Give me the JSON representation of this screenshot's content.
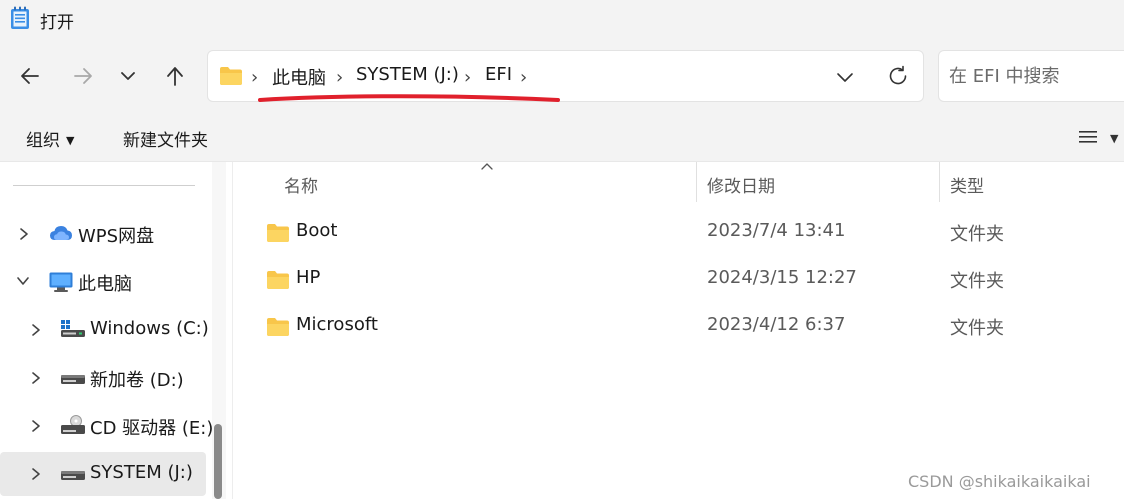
{
  "window": {
    "title": "打开"
  },
  "navigation": {
    "breadcrumb": [
      "此电脑",
      "SYSTEM (J:)",
      "EFI"
    ],
    "search_placeholder": "在 EFI 中搜索"
  },
  "toolbar": {
    "organize_label": "组织",
    "new_folder_label": "新建文件夹"
  },
  "sidebar": {
    "items": [
      {
        "label": "WPS网盘",
        "icon": "cloud-icon",
        "expanded": false
      },
      {
        "label": "此电脑",
        "icon": "computer-icon",
        "expanded": true
      },
      {
        "label": "Windows (C:)",
        "icon": "windows-drive-icon",
        "expanded": false
      },
      {
        "label": "新加卷 (D:)",
        "icon": "drive-icon",
        "expanded": false
      },
      {
        "label": "CD 驱动器 (E:)",
        "icon": "cd-drive-icon",
        "expanded": false
      },
      {
        "label": "SYSTEM (J:)",
        "icon": "drive-icon",
        "expanded": false,
        "selected": true
      }
    ]
  },
  "file_list": {
    "columns": [
      "名称",
      "修改日期",
      "类型"
    ],
    "rows": [
      {
        "name": "Boot",
        "modified": "2023/7/4 13:41",
        "type": "文件夹"
      },
      {
        "name": "HP",
        "modified": "2024/3/15 12:27",
        "type": "文件夹"
      },
      {
        "name": "Microsoft",
        "modified": "2023/4/12 6:37",
        "type": "文件夹"
      }
    ]
  },
  "watermark": "CSDN @shikaikaikaikai",
  "colors": {
    "folder": "#f8c64a",
    "annotation": "#e0202c",
    "selected_row": "#e9e9e9"
  }
}
